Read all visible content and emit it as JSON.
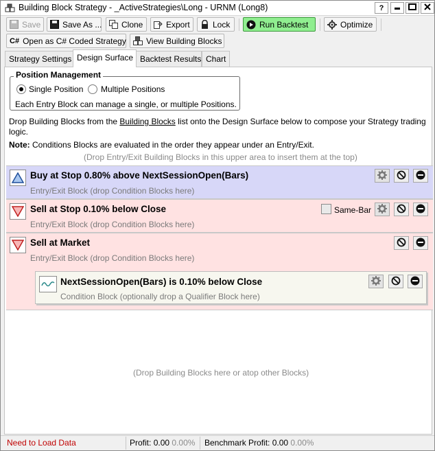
{
  "window": {
    "title": "Building Block Strategy - _ActiveStrategies\\Long - URNM (Long8)",
    "help_label": "?",
    "minimize_label": "▬",
    "maximize_label": "▣",
    "close_label": "✕"
  },
  "toolbar": {
    "save_label": "Save",
    "save_as_label": "Save As ...",
    "clone_label": "Clone",
    "export_label": "Export",
    "lock_label": "Lock",
    "run_backtest_label": "Run Backtest",
    "optimize_label": "Optimize",
    "open_csharp_label": "Open as C# Coded Strategy",
    "csharp_icon_text": "C#",
    "view_blocks_label": "View Building Blocks"
  },
  "tabs": [
    {
      "label": "Strategy Settings"
    },
    {
      "label": "Design Surface"
    },
    {
      "label": "Backtest Results"
    },
    {
      "label": "Chart"
    }
  ],
  "position_management": {
    "title": "Position Management",
    "single_label": "Single Position",
    "multiple_label": "Multiple Positions",
    "selected": "single",
    "description": "Each Entry Block can manage a single, or multiple Positions."
  },
  "instructions": {
    "line1_pre": "Drop Building Blocks from the ",
    "line1_link": "Building Blocks",
    "line1_post": " list onto the Design Surface below to compose your Strategy trading",
    "line2": "logic.",
    "note_label": "Note:",
    "note_text": " Conditions Blocks are evaluated in the order they appear under an Entry/Exit.",
    "drop_hint_top": "(Drop Entry/Exit Building Blocks in this upper area to insert them at the top)"
  },
  "blocks": [
    {
      "title": "Buy at Stop 0.80% above NextSessionOpen(Bars)",
      "subtitle": "Entry/Exit Block (drop Condition Blocks here)",
      "kind": "buy"
    },
    {
      "title": "Sell at Stop 0.10% below Close",
      "subtitle": "Entry/Exit Block (drop Condition Blocks here)",
      "kind": "sell",
      "same_bar_label": "Same-Bar",
      "same_bar_checked": false
    },
    {
      "title": "Sell at Market",
      "subtitle": "Entry/Exit Block (drop Condition Blocks here)",
      "kind": "sell"
    }
  ],
  "condition_block": {
    "title": "NextSessionOpen(Bars) is 0.10% below Close",
    "subtitle": "Condition Block (optionally drop a Qualifier Block here)"
  },
  "drop_hint_bottom": "(Drop Building Blocks here or atop other Blocks)",
  "status_bar": {
    "load_status": "Need to Load Data",
    "profit_label": "Profit:",
    "profit_value": "0.00",
    "profit_pct": "0.00%",
    "benchmark_label": "Benchmark Profit:",
    "benchmark_value": "0.00",
    "benchmark_pct": "0.00%"
  },
  "colors": {
    "buy_block_bg": "#d7d7f8",
    "sell_block_bg": "#ffe2e2",
    "run_backtest_bg": "#90ee90",
    "status_error": "#c00000"
  }
}
